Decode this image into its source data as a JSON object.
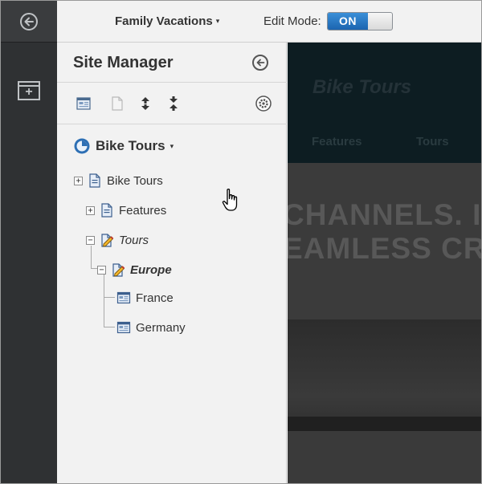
{
  "topbar": {
    "site_name": "Family Vacations",
    "site_caret": "▾",
    "edit_mode_label": "Edit Mode:",
    "edit_mode_value": "ON"
  },
  "rail": {
    "items": [
      {
        "name": "back-arrow-icon"
      },
      {
        "name": "add-page-icon"
      }
    ]
  },
  "site_manager": {
    "title": "Site Manager",
    "toolbar": [
      {
        "name": "new-page-icon"
      },
      {
        "name": "duplicate-page-icon"
      },
      {
        "name": "move-up-icon"
      },
      {
        "name": "move-down-icon"
      },
      {
        "name": "settings-icon"
      }
    ],
    "current_site": "Bike Tours",
    "current_site_caret": "▾",
    "tree": [
      {
        "label": "Bike Tours",
        "expander": "+",
        "icon": "page-icon"
      },
      {
        "label": "Features",
        "expander": "+",
        "icon": "page-icon"
      },
      {
        "label": "Tours",
        "expander": "−",
        "icon": "edited-page-icon",
        "style": "italic"
      },
      {
        "label": "Europe",
        "expander": "−",
        "icon": "edited-page-icon",
        "style": "bold-italic"
      },
      {
        "label": "France",
        "icon": "layout-page-icon"
      },
      {
        "label": "Germany",
        "icon": "layout-page-icon"
      }
    ]
  },
  "preview": {
    "site_title": "Bike Tours",
    "nav": [
      "Features",
      "Tours"
    ],
    "hero_line1": "CHANNELS. I",
    "hero_line2": "EAMLESS CRO"
  },
  "colors": {
    "rail": "#2f3133",
    "panel": "#f2f2f2",
    "toggle_on": "#1c65b0",
    "preview_dim": "#3b3b3b"
  }
}
